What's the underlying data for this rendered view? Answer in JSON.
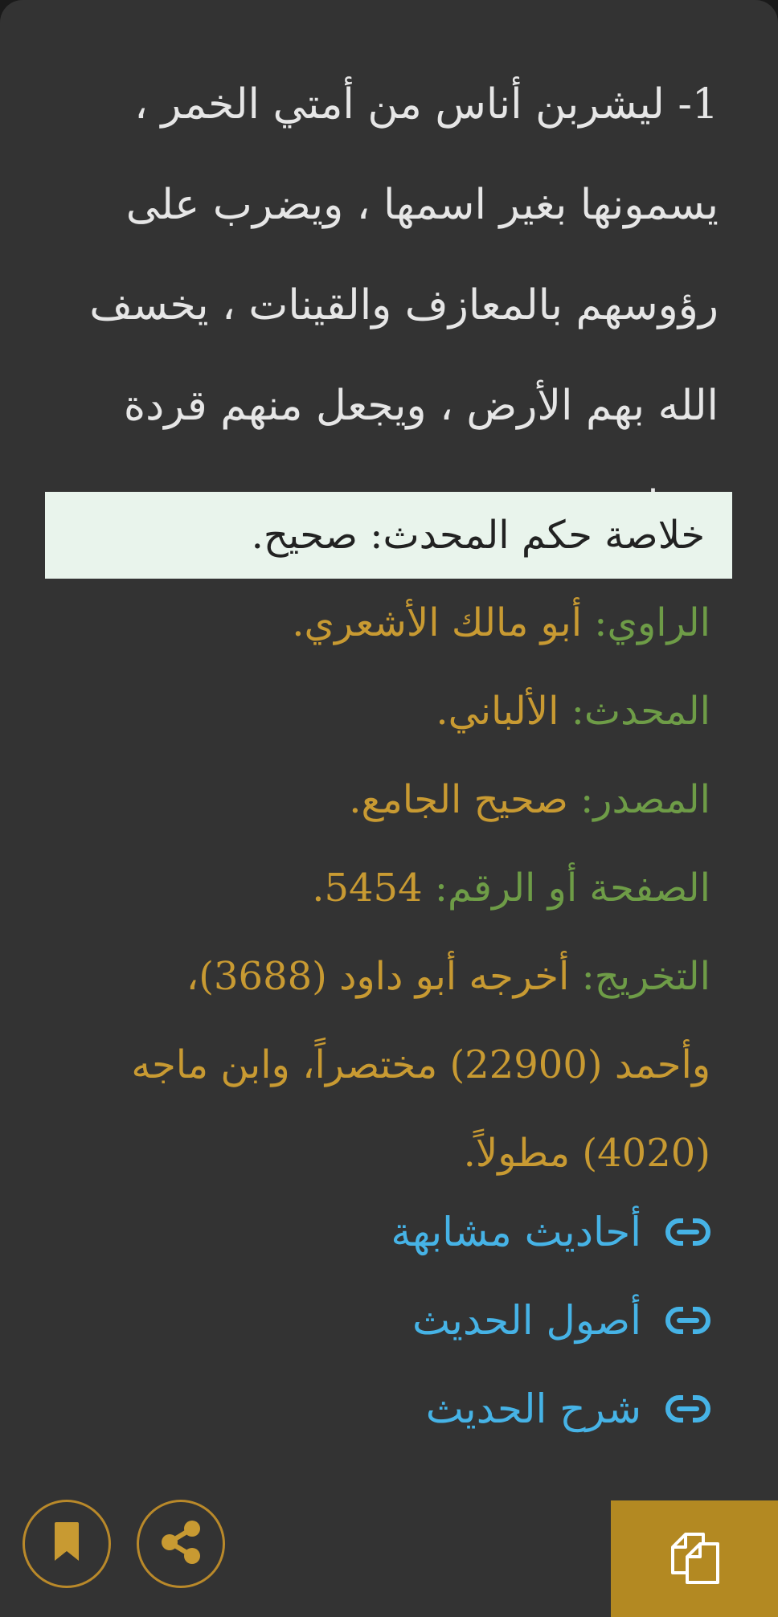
{
  "hadith": {
    "text": "1-  ليشربن أناس من أمتي الخمر ، يسمونها بغير اسمها ، ويضرب على رؤوسهم بالمعازف والقينات ، يخسف الله بهم الأرض ، ويجعل منهم قردة وخنازير"
  },
  "verdict": {
    "text": "خلاصة حكم المحدث: صحيح."
  },
  "meta": {
    "narrator_label": "الراوي:",
    "narrator_value": "أبو مالك الأشعري.",
    "muhaddith_label": "المحدث:",
    "muhaddith_value": "الألباني.",
    "source_label": "المصدر:",
    "source_value": "صحيح الجامع.",
    "page_label": "الصفحة أو الرقم:",
    "page_value": "5454.",
    "takhrij_label": "التخريج:",
    "takhrij_value": "أخرجه أبو داود (3688)، وأحمد (22900) مختصراً، وابن ماجه (4020) مطولاً."
  },
  "links": [
    {
      "label": "أحاديث مشابهة",
      "icon": "link-icon"
    },
    {
      "label": "أصول الحديث",
      "icon": "link-icon"
    },
    {
      "label": "شرح الحديث",
      "icon": "link-icon"
    }
  ],
  "actions": {
    "bookmark_icon": "bookmark-icon",
    "share_icon": "share-icon",
    "copy_icon": "copy-icon"
  },
  "colors": {
    "background": "#333333",
    "text": "#e6e6e6",
    "label": "#6e9c47",
    "value": "#c89a32",
    "link": "#46b3e6",
    "accent": "#b38922",
    "verdict_bg": "#e9f4ec"
  }
}
